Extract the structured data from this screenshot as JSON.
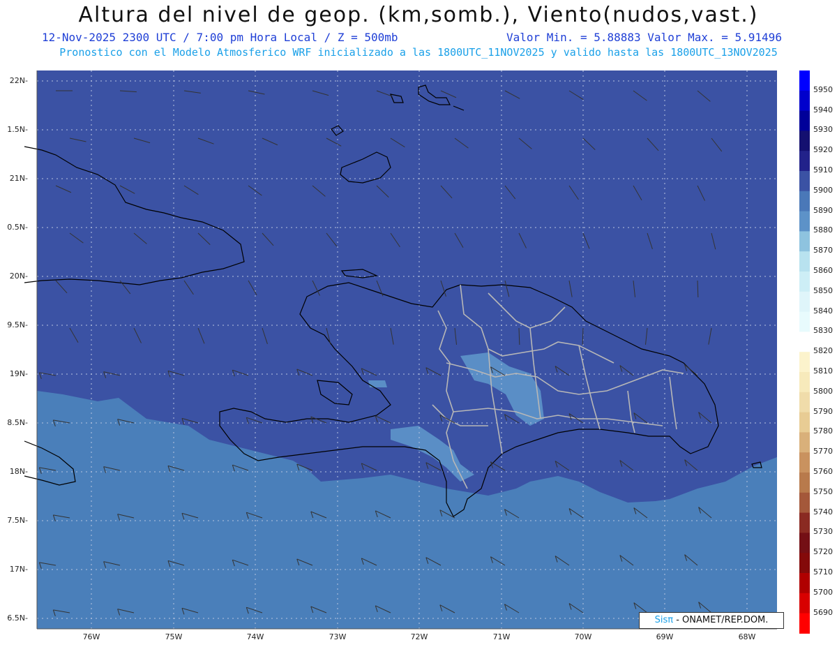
{
  "title": "Altura del nivel de geop. (km,somb.), Viento(nudos,vast.)",
  "subtitle_left": "12-Nov-2025  2300 UTC / 7:00 pm Hora Local / Z = 500mb",
  "subtitle_right": "Valor Min. = 5.88883  Valor Max. = 5.91496",
  "subtitle2": "Pronostico con el Modelo Atmosferico WRF inicializado a las 1800UTC_11NOV2025 y valido hasta las  1800UTC_13NOV2025",
  "credit": {
    "sis": "Sisπ",
    "rest": " - ONAMET/REP.DOM."
  },
  "lat_labels": [
    "22N",
    "1.5N",
    "21N",
    "0.5N",
    "20N",
    "9.5N",
    "19N",
    "8.5N",
    "18N",
    "7.5N",
    "17N",
    "6.5N"
  ],
  "lon_labels": [
    "76W",
    "75W",
    "74W",
    "73W",
    "72W",
    "71W",
    "70W",
    "69W",
    "68W"
  ],
  "colorbar": {
    "labels": [
      "5950",
      "5940",
      "5930",
      "5920",
      "5910",
      "5900",
      "5890",
      "5880",
      "5870",
      "5860",
      "5850",
      "5840",
      "5830",
      "5820",
      "5810",
      "5800",
      "5790",
      "5780",
      "5770",
      "5760",
      "5750",
      "5740",
      "5730",
      "5720",
      "5710",
      "5700",
      "5690"
    ],
    "colors": [
      "#0000ff",
      "#0000cc",
      "#000099",
      "#141070",
      "#22228a",
      "#3b52a4",
      "#4a78b8",
      "#5d92c8",
      "#8ec3df",
      "#b8e2ef",
      "#cdeef6",
      "#dff5fa",
      "#e8fbfd",
      "#ffffff",
      "#fcf3cc",
      "#f7eabb",
      "#f0dcaa",
      "#e8cc94",
      "#d9b07a",
      "#c9925f",
      "#b87a4c",
      "#a4583a",
      "#8a2a22",
      "#740f15",
      "#840a0a",
      "#b00000",
      "#d80000",
      "#ff0000"
    ]
  },
  "fill_colors": {
    "sea_north": "#3b52a4",
    "sea_south": "#4a7fba",
    "land_patch": "#5a8ec6"
  }
}
